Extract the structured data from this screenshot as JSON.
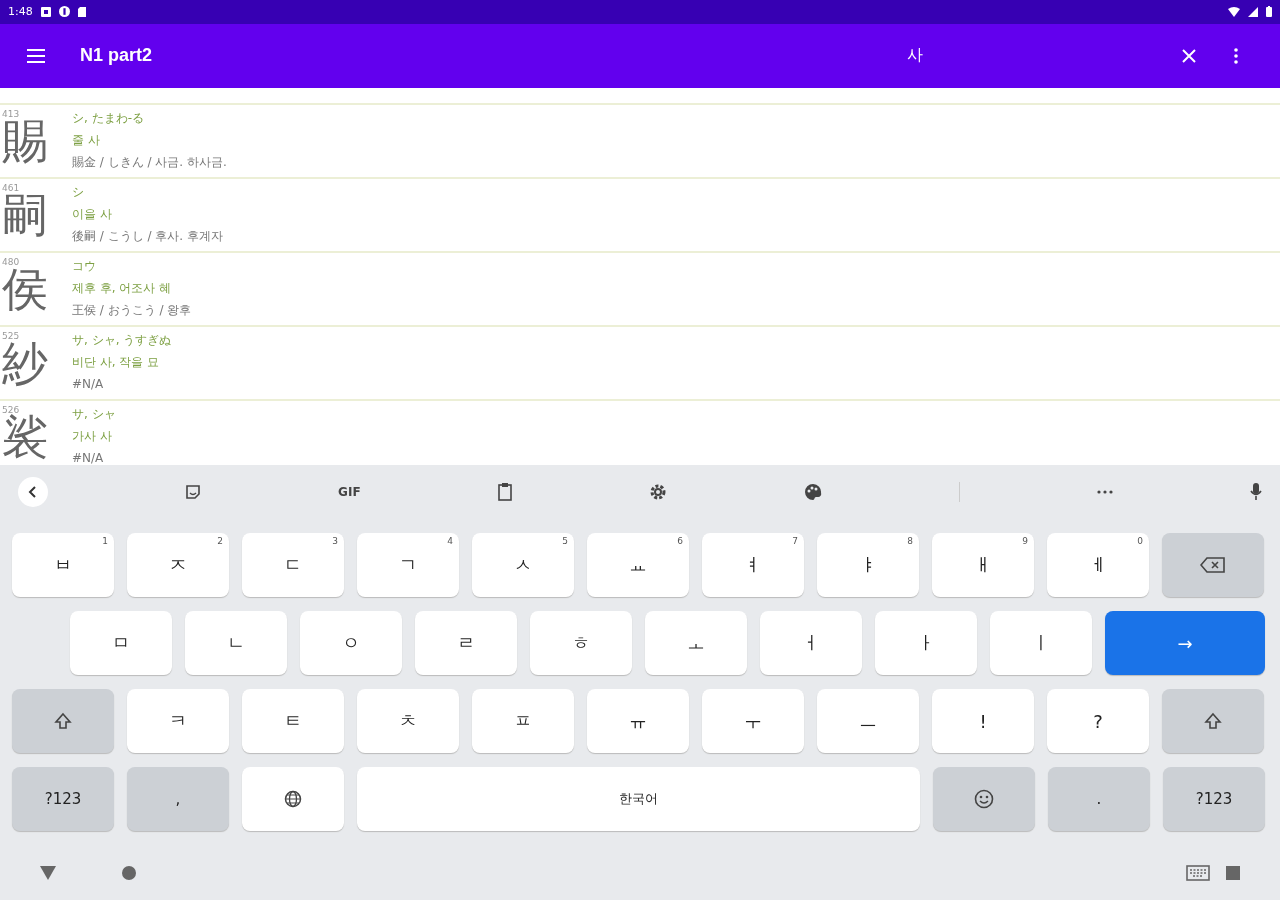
{
  "status_bar": {
    "time": "1:48"
  },
  "app_bar": {
    "title": "N1 part2",
    "query": "사"
  },
  "entries": [
    {
      "number": "413",
      "kanji": "賜",
      "reading": "シ, たまわ-る",
      "meaning": "줄 사",
      "example": "賜金 / しきん / 사금. 하사금."
    },
    {
      "number": "461",
      "kanji": "嗣",
      "reading": "シ",
      "meaning": "이을 사",
      "example": "後嗣 / こうし / 후사. 후계자"
    },
    {
      "number": "480",
      "kanji": "侯",
      "reading": "コウ",
      "meaning": "제후 후, 어조사 혜",
      "example": "王侯 / おうこう / 왕후"
    },
    {
      "number": "525",
      "kanji": "紗",
      "reading": "サ, シャ, うすぎぬ",
      "meaning": "비단 사, 작을 묘",
      "example": "#N/A"
    },
    {
      "number": "526",
      "kanji": "裟",
      "reading": "サ, シャ",
      "meaning": "가사 사",
      "example": "#N/A"
    }
  ],
  "keyboard_toolbar": {
    "gif_label": "GIF"
  },
  "keyboard_rows": [
    [
      {
        "kind": "char",
        "label": "ㅂ",
        "hint": "1"
      },
      {
        "kind": "char",
        "label": "ㅈ",
        "hint": "2"
      },
      {
        "kind": "char",
        "label": "ㄷ",
        "hint": "3"
      },
      {
        "kind": "char",
        "label": "ㄱ",
        "hint": "4"
      },
      {
        "kind": "char",
        "label": "ㅅ",
        "hint": "5"
      },
      {
        "kind": "char",
        "label": "ㅛ",
        "hint": "6"
      },
      {
        "kind": "char",
        "label": "ㅕ",
        "hint": "7"
      },
      {
        "kind": "char",
        "label": "ㅑ",
        "hint": "8"
      },
      {
        "kind": "char",
        "label": "ㅐ",
        "hint": "9"
      },
      {
        "kind": "char",
        "label": "ㅔ",
        "hint": "0"
      },
      {
        "kind": "backspace"
      }
    ],
    [
      {
        "kind": "char",
        "label": "ㅁ"
      },
      {
        "kind": "char",
        "label": "ㄴ"
      },
      {
        "kind": "char",
        "label": "ㅇ"
      },
      {
        "kind": "char",
        "label": "ㄹ"
      },
      {
        "kind": "char",
        "label": "ㅎ"
      },
      {
        "kind": "char",
        "label": "ㅗ"
      },
      {
        "kind": "char",
        "label": "ㅓ"
      },
      {
        "kind": "char",
        "label": "ㅏ"
      },
      {
        "kind": "char",
        "label": "ㅣ"
      },
      {
        "kind": "enter",
        "label": "→"
      }
    ],
    [
      {
        "kind": "shift"
      },
      {
        "kind": "char",
        "label": "ㅋ"
      },
      {
        "kind": "char",
        "label": "ㅌ"
      },
      {
        "kind": "char",
        "label": "ㅊ"
      },
      {
        "kind": "char",
        "label": "ㅍ"
      },
      {
        "kind": "char",
        "label": "ㅠ"
      },
      {
        "kind": "char",
        "label": "ㅜ"
      },
      {
        "kind": "char",
        "label": "ㅡ"
      },
      {
        "kind": "char",
        "label": "!"
      },
      {
        "kind": "char",
        "label": "?"
      },
      {
        "kind": "shift"
      }
    ],
    [
      {
        "kind": "mod",
        "label": "?123"
      },
      {
        "kind": "mod",
        "label": ","
      },
      {
        "kind": "globe"
      },
      {
        "kind": "space",
        "label": "한국어"
      },
      {
        "kind": "emoji"
      },
      {
        "kind": "mod",
        "label": "."
      },
      {
        "kind": "mod",
        "label": "?123"
      }
    ]
  ]
}
